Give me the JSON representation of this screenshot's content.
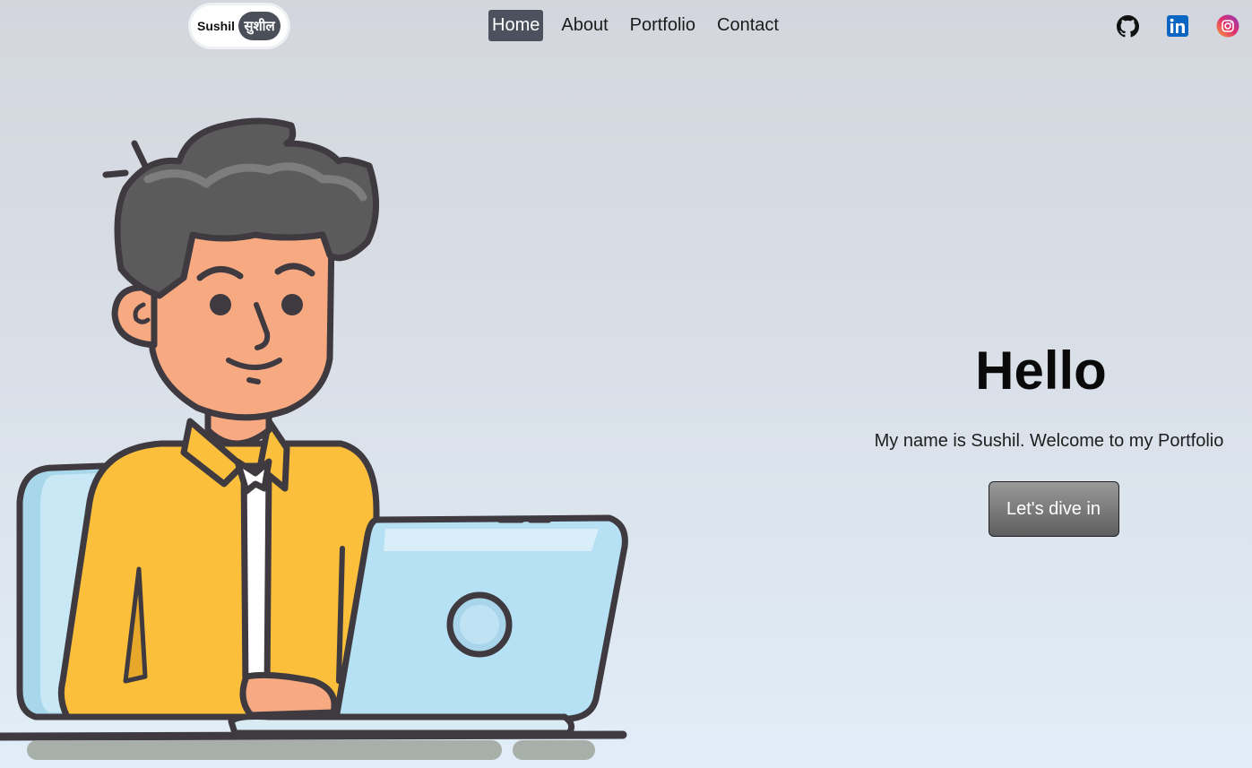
{
  "logo": {
    "text_en": "Sushil",
    "text_hi": "सुशील"
  },
  "nav": {
    "items": [
      {
        "label": "Home",
        "active": true
      },
      {
        "label": "About",
        "active": false
      },
      {
        "label": "Portfolio",
        "active": false
      },
      {
        "label": "Contact",
        "active": false
      }
    ]
  },
  "social": {
    "icons": [
      "github-icon",
      "linkedin-icon",
      "instagram-icon"
    ]
  },
  "hero": {
    "title": "Hello",
    "subtitle": "My name is Sushil. Welcome to my Portfolio",
    "cta_label": "Let's dive in"
  },
  "colors": {
    "nav_active_bg": "#4c525d",
    "shirt": "#fbbf3b",
    "laptop": "#b6e1f4",
    "hair": "#5b5b5b",
    "skin": "#f7a982",
    "linkedin": "#0a66c2"
  }
}
